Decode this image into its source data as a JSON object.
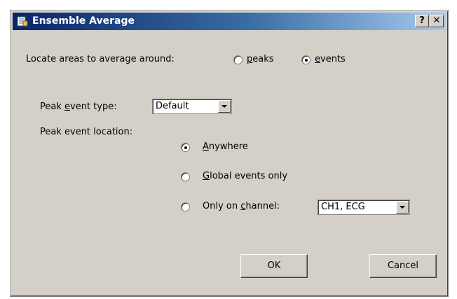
{
  "window": {
    "title": "Ensemble Average",
    "help_label": "?",
    "close_label": "✕"
  },
  "locate": {
    "label": "Locate areas to average around:",
    "options": [
      {
        "label": "peaks",
        "mnemonic": "p",
        "rest": "eaks",
        "selected": false
      },
      {
        "label": "events",
        "mnemonic": "e",
        "rest": "vents",
        "selected": true
      }
    ]
  },
  "peak_event_type": {
    "label_pre": "Peak ",
    "label_mnemonic": "e",
    "label_post": "vent type:",
    "value": "Default"
  },
  "peak_event_location": {
    "label": "Peak event location:",
    "options": [
      {
        "label": "Anywhere",
        "mnemonic": "A",
        "rest": "nywhere",
        "selected": true
      },
      {
        "label": "Global events only",
        "mnemonic": "G",
        "rest": "lobal events only",
        "selected": false
      },
      {
        "label": "Only on channel:",
        "pre": "Only on ",
        "mnemonic": "c",
        "rest": "hannel:",
        "selected": false
      }
    ],
    "channel_value": "CH1, ECG"
  },
  "buttons": {
    "ok": "OK",
    "cancel": "Cancel"
  },
  "colors": {
    "dialog_bg": "#d4d0c8",
    "title_start": "#0a246a",
    "title_end": "#a6caf0"
  }
}
